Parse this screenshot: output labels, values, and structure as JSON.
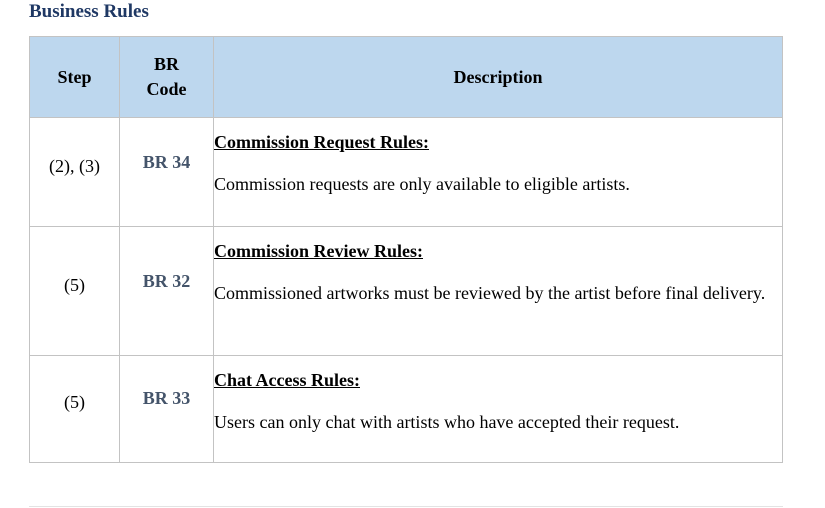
{
  "section": {
    "title": "Business Rules"
  },
  "table": {
    "headers": {
      "step": "Step",
      "br_code_line1": "BR",
      "br_code_line2": "Code",
      "description": "Description"
    },
    "rows": [
      {
        "step": "(2), (3)",
        "code": "BR 34",
        "rule_title": "Commission Request Rules:",
        "rule_text": "Commission requests are only available to eligible artists."
      },
      {
        "step": "(5)",
        "code": "BR 32",
        "rule_title": "Commission Review Rules:",
        "rule_text": "Commissioned artworks must be reviewed by the artist before final delivery."
      },
      {
        "step": "(5)",
        "code": "BR 33",
        "rule_title": "Chat Access Rules:",
        "rule_text": "Users can only chat with artists who have accepted their request."
      }
    ]
  },
  "colors": {
    "title": "#1f3864",
    "header_bg": "#bdd7ee",
    "code_text": "#44546a",
    "border": "#c3c3c3"
  }
}
